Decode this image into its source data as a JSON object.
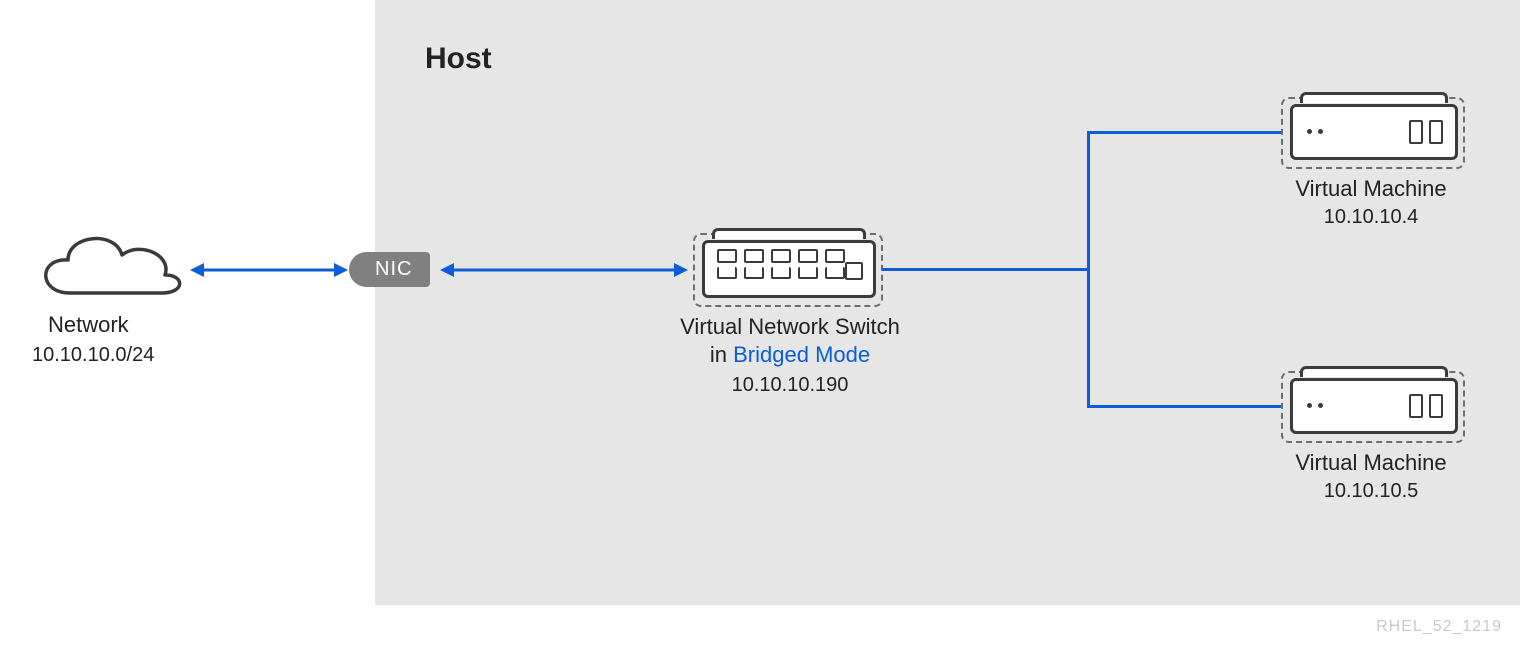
{
  "host": {
    "title": "Host"
  },
  "nic": {
    "label": "NIC"
  },
  "network": {
    "label": "Network",
    "subnet": "10.10.10.0/24"
  },
  "switch": {
    "label_line1": "Virtual Network Switch",
    "label_line2_prefix": "in ",
    "label_line2_accent": "Bridged Mode",
    "ip": "10.10.10.190"
  },
  "vms": [
    {
      "label": "Virtual Machine",
      "ip": "10.10.10.4"
    },
    {
      "label": "Virtual Machine",
      "ip": "10.10.10.5"
    }
  ],
  "footer_ref": "RHEL_52_1219",
  "colors": {
    "accent": "#0b5ed7",
    "panel_bg": "#e6e6e6",
    "nic_bg": "#808080",
    "icon_stroke": "#3b3b3b"
  }
}
